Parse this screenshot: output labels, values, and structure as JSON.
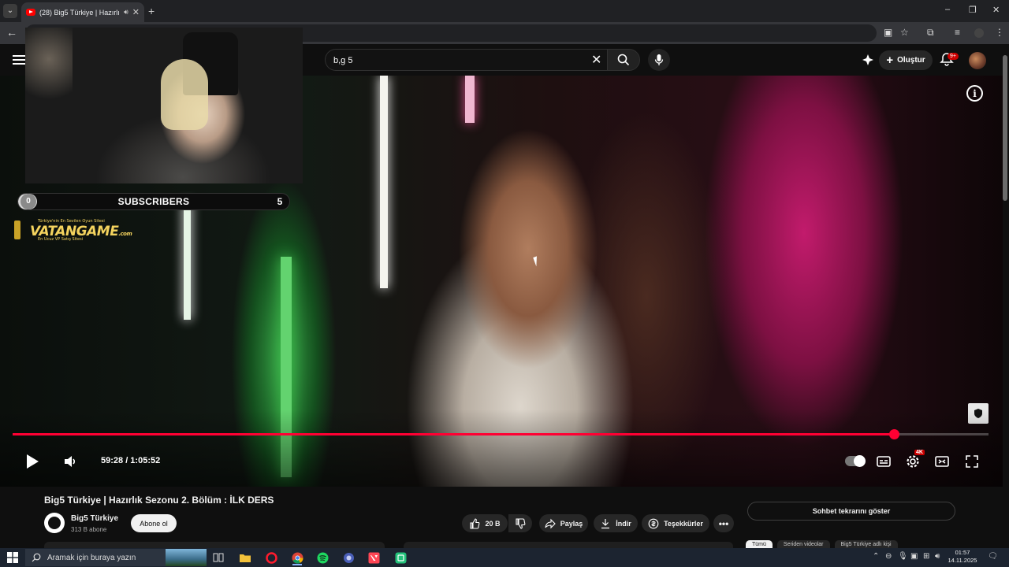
{
  "browser": {
    "tab_title": "(28) Big5 Türkiye | Hazırlık S",
    "new_tab_label": "+",
    "window_controls": [
      "–",
      "❐",
      "✕"
    ]
  },
  "header": {
    "search_value": "b,g 5",
    "create_label": "Oluştur",
    "notifications_badge": "9+"
  },
  "overlay": {
    "subs_current": "0",
    "subs_label": "SUBSCRIBERS",
    "subs_goal": "5",
    "subs_progress_fraction": 0.07,
    "sponsor_tagline": "Türkiye'nin En Sevilen Oyun Sitesi",
    "sponsor_name": "VATANGAME",
    "sponsor_domain": ".com",
    "sponsor_sub": "En Ucuz VP Satış Sitesi"
  },
  "player": {
    "time_display": "59:28 / 1:05:52",
    "progress_fraction": 0.903,
    "quality_badge": "4K"
  },
  "video": {
    "title": "Big5 Türkiye | Hazırlık Sezonu 2. Bölüm : İLK DERS",
    "channel_name": "Big5 Türkiye",
    "channel_subs": "313 B abone",
    "subscribe_label": "Abone ol",
    "like_count": "20 B",
    "share_label": "Paylaş",
    "download_label": "İndir",
    "thanks_label": "Teşekkürler",
    "chat_replay_label": "Sohbet tekrarını göster",
    "chips": [
      "Tümü",
      "Seriden videolar",
      "Big5 Türkiye adlı kişi"
    ]
  },
  "taskbar": {
    "search_placeholder": "Aramak için buraya yazın",
    "time": "01:57",
    "date": "14.11.2025"
  },
  "colors": {
    "accent": "#ff0033",
    "background": "#0f0f0f",
    "taskbar": "#1c2430"
  }
}
